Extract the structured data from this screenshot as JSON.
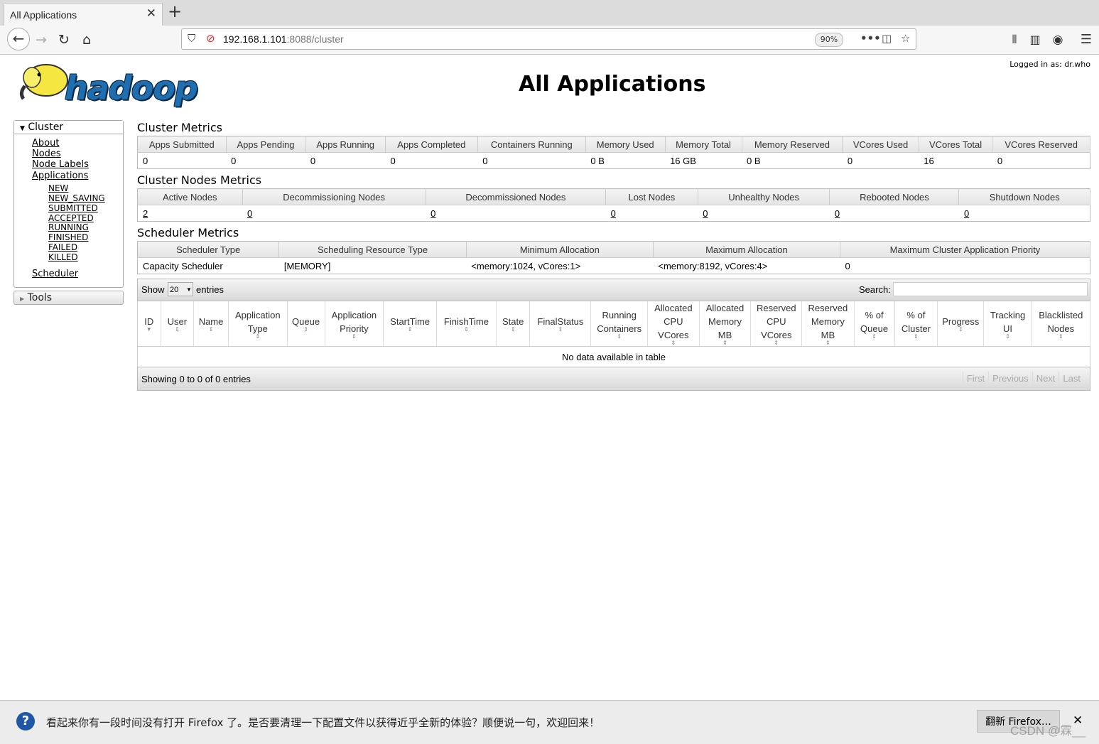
{
  "browser": {
    "tab_title": "All Applications",
    "url_host": "192.168.1.101",
    "url_path": ":8088/cluster",
    "zoom": "90%"
  },
  "header": {
    "logo_text": "hadoop",
    "title": "All Applications",
    "logged_in": "Logged in as: dr.who"
  },
  "sidebar": {
    "cluster_label": "Cluster",
    "links": [
      "About",
      "Nodes",
      "Node Labels",
      "Applications"
    ],
    "app_states": [
      "NEW",
      "NEW_SAVING",
      "SUBMITTED",
      "ACCEPTED",
      "RUNNING",
      "FINISHED",
      "FAILED",
      "KILLED"
    ],
    "scheduler": "Scheduler",
    "tools_label": "Tools"
  },
  "cluster_metrics": {
    "title": "Cluster Metrics",
    "headers": [
      "Apps Submitted",
      "Apps Pending",
      "Apps Running",
      "Apps Completed",
      "Containers Running",
      "Memory Used",
      "Memory Total",
      "Memory Reserved",
      "VCores Used",
      "VCores Total",
      "VCores Reserved"
    ],
    "values": [
      "0",
      "0",
      "0",
      "0",
      "0",
      "0 B",
      "16 GB",
      "0 B",
      "0",
      "16",
      "0"
    ]
  },
  "node_metrics": {
    "title": "Cluster Nodes Metrics",
    "headers": [
      "Active Nodes",
      "Decommissioning Nodes",
      "Decommissioned Nodes",
      "Lost Nodes",
      "Unhealthy Nodes",
      "Rebooted Nodes",
      "Shutdown Nodes"
    ],
    "values": [
      "2",
      "0",
      "0",
      "0",
      "0",
      "0",
      "0"
    ]
  },
  "scheduler_metrics": {
    "title": "Scheduler Metrics",
    "headers": [
      "Scheduler Type",
      "Scheduling Resource Type",
      "Minimum Allocation",
      "Maximum Allocation",
      "Maximum Cluster Application Priority"
    ],
    "values": [
      "Capacity Scheduler",
      "[MEMORY]",
      "<memory:1024, vCores:1>",
      "<memory:8192, vCores:4>",
      "0"
    ]
  },
  "apps_table": {
    "show_label": "Show",
    "page_size": "20",
    "entries_label": "entries",
    "search_label": "Search:",
    "columns": [
      "ID",
      "User",
      "Name",
      "Application Type",
      "Queue",
      "Application Priority",
      "StartTime",
      "FinishTime",
      "State",
      "FinalStatus",
      "Running Containers",
      "Allocated CPU VCores",
      "Allocated Memory MB",
      "Reserved CPU VCores",
      "Reserved Memory MB",
      "% of Queue",
      "% of Cluster",
      "Progress",
      "Tracking UI",
      "Blacklisted Nodes"
    ],
    "empty_message": "No data available in table",
    "showing": "Showing 0 to 0 of 0 entries",
    "pager": [
      "First",
      "Previous",
      "Next",
      "Last"
    ]
  },
  "notification": {
    "text": "看起来你有一段时间没有打开 Firefox 了。是否要清理一下配置文件以获得近乎全新的体验？顺便说一句，欢迎回来！",
    "button": "翻新 Firefox…",
    "close": "✕"
  },
  "watermark": "CSDN @霖__"
}
